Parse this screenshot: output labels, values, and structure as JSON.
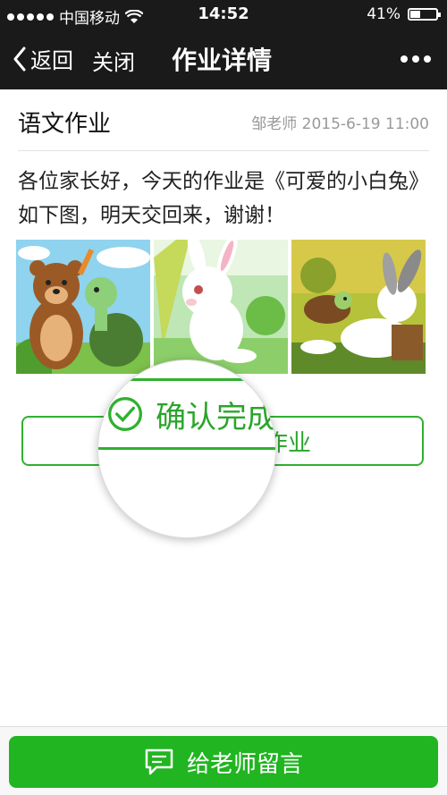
{
  "status": {
    "carrier": "中国移动",
    "time": "14:52",
    "battery": "41%",
    "battery_level": 0.41
  },
  "nav": {
    "back_label": "返回",
    "close_label": "关闭",
    "title": "作业详情"
  },
  "homework": {
    "subject": "语文作业",
    "meta": "邹老师 2015-6-19 11:00",
    "message": "各位家长好，今天的作业是《可爱的小白兔》如下图，明天交回来，谢谢！",
    "images": [
      "bear-and-turtle-image",
      "white-rabbit-image",
      "turtle-and-rabbit-image"
    ]
  },
  "actions": {
    "confirm_label": "确认完成作业",
    "message_teacher_label": "给老师留言"
  },
  "colors": {
    "accent": "#21b521",
    "nav_bg": "#1a1a1a"
  }
}
